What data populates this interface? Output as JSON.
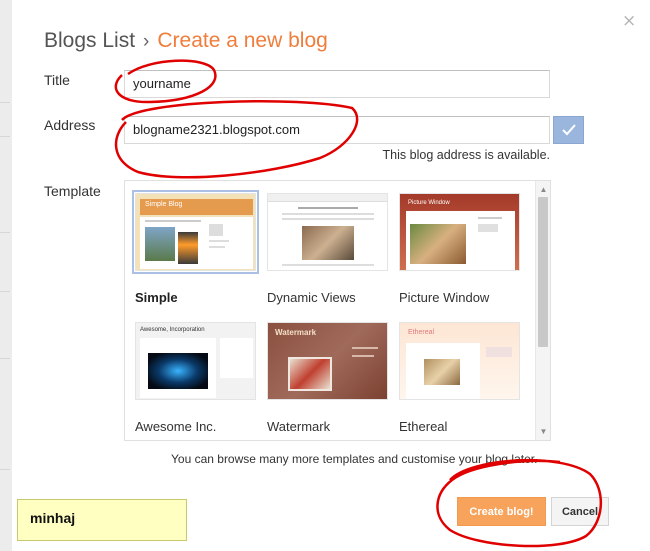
{
  "breadcrumb": {
    "parent": "Blogs List",
    "separator": "›",
    "current": "Create a new blog"
  },
  "close_glyph": "×",
  "form": {
    "title_label": "Title",
    "title_value": "yourname",
    "address_label": "Address",
    "address_value": "blogname2321.blogspot.com",
    "address_status": "This blog address is available.",
    "template_label": "Template"
  },
  "templates": [
    {
      "name": "Simple",
      "selected": true,
      "header_text": "Simple Blog"
    },
    {
      "name": "Dynamic Views",
      "selected": false,
      "header_text": ""
    },
    {
      "name": "Picture Window",
      "selected": false,
      "header_text": "Picture Window"
    },
    {
      "name": "Awesome Inc.",
      "selected": false,
      "header_text": "Awesome, Incorporation"
    },
    {
      "name": "Watermark",
      "selected": false,
      "header_text": "Watermark"
    },
    {
      "name": "Ethereal",
      "selected": false,
      "header_text": "Ethereal"
    }
  ],
  "browse_hint": "You can browse many more templates and customise your blog later.",
  "buttons": {
    "create": "Create blog!",
    "cancel": "Cancel"
  },
  "annotation_note": "minhaj",
  "colors": {
    "accent": "#f07d3c",
    "create_button": "#f7a35c",
    "check_button": "#9bb6dd",
    "annotation_stroke": "#e00000",
    "note_bg": "#ffffc1"
  }
}
